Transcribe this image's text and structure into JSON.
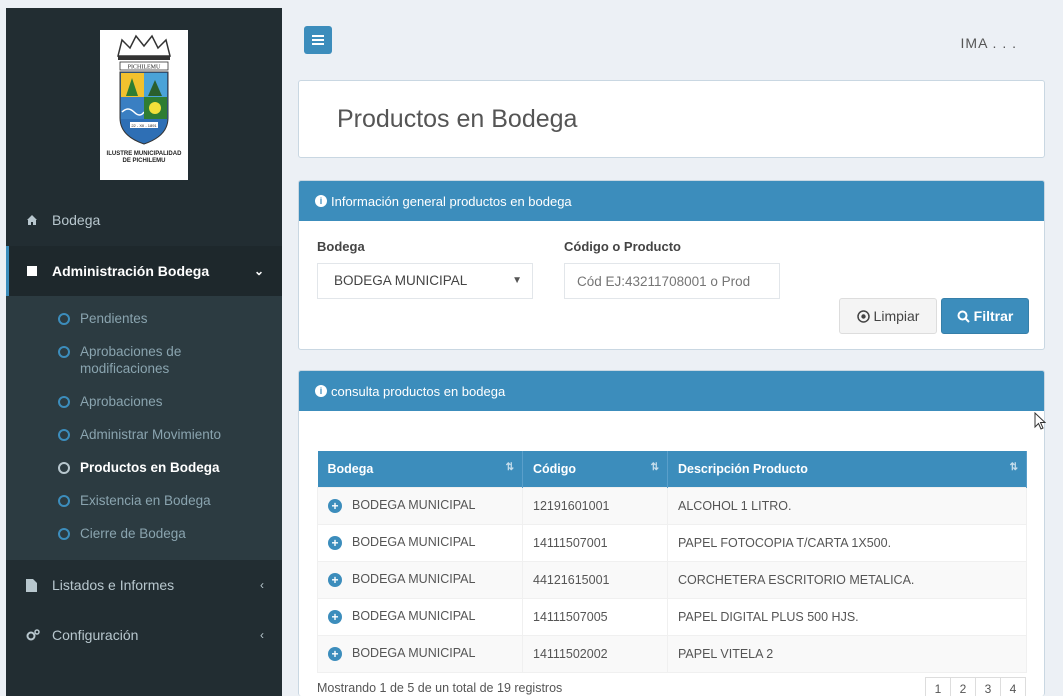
{
  "sidebar": {
    "logo": {
      "city": "PICHILEMU",
      "date_text": "22 - XII - 1891",
      "caption_line1": "ILUSTRE MUNICIPALIDAD",
      "caption_line2": "DE PICHILEMU"
    },
    "menu": [
      {
        "label": "Bodega",
        "icon": "home-icon"
      },
      {
        "label": "Administración Bodega",
        "icon": "book-icon"
      },
      {
        "label": "Listados e Informes",
        "icon": "file-icon"
      },
      {
        "label": "Configuración",
        "icon": "cogs-icon"
      }
    ],
    "submenu": [
      {
        "label": "Pendientes"
      },
      {
        "label": "Aprobaciones de modificaciones"
      },
      {
        "label": "Aprobaciones"
      },
      {
        "label": "Administrar Movimiento"
      },
      {
        "label": "Productos en Bodega"
      },
      {
        "label": "Existencia en Bodega"
      },
      {
        "label": "Cierre de Bodega"
      }
    ]
  },
  "header": {
    "user": "IMA . . ."
  },
  "page": {
    "title": "Productos en Bodega"
  },
  "filter": {
    "panel_title": "Información general productos en bodega",
    "bodega_label": "Bodega",
    "bodega_value": "BODEGA MUNICIPAL",
    "codigo_label": "Código o Producto",
    "codigo_placeholder": "Cód EJ:43211708001 o Prod",
    "clear_label": "Limpiar",
    "filter_label": "Filtrar"
  },
  "results": {
    "panel_title": "consulta productos en bodega",
    "columns": [
      "Bodega",
      "Código",
      "Descripción Producto"
    ],
    "rows": [
      {
        "bodega": "BODEGA MUNICIPAL",
        "codigo": "12191601001",
        "descripcion": "ALCOHOL 1 LITRO."
      },
      {
        "bodega": "BODEGA MUNICIPAL",
        "codigo": "14111507001",
        "descripcion": "PAPEL FOTOCOPIA T/CARTA 1X500."
      },
      {
        "bodega": "BODEGA MUNICIPAL",
        "codigo": "44121615001",
        "descripcion": "CORCHETERA ESCRITORIO METALICA."
      },
      {
        "bodega": "BODEGA MUNICIPAL",
        "codigo": "14111507005",
        "descripcion": "PAPEL DIGITAL PLUS 500 HJS."
      },
      {
        "bodega": "BODEGA MUNICIPAL",
        "codigo": "14111502002",
        "descripcion": "PAPEL VITELA 2"
      }
    ],
    "footer_text": "Mostrando 1 de 5 de un total de 19 registros",
    "pages": [
      "1",
      "2",
      "3",
      "4"
    ]
  },
  "colors": {
    "sidebar_bg": "#222d32",
    "accent": "#3c8dbc",
    "content_bg": "#ecf0f5"
  }
}
